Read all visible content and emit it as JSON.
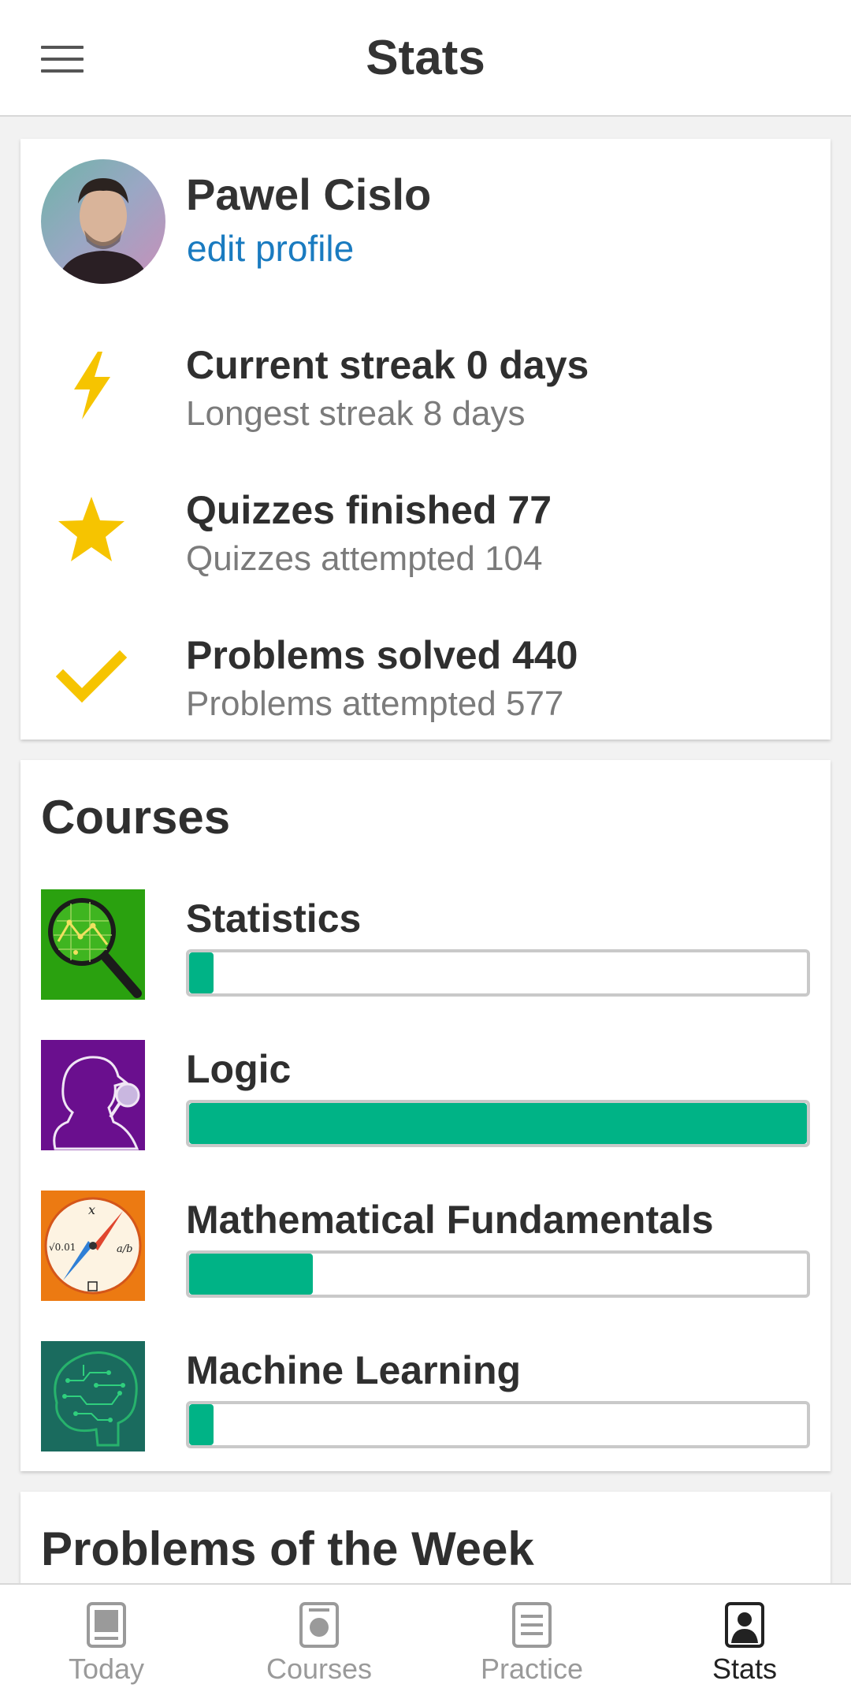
{
  "app_bar": {
    "title": "Stats",
    "menu_icon": "hamburger-menu-icon"
  },
  "profile": {
    "name": "Pawel Cislo",
    "edit_label": "edit profile",
    "stats": [
      {
        "icon": "lightning-icon",
        "main": "Current streak 0 days",
        "sub": "Longest streak 8 days"
      },
      {
        "icon": "star-icon",
        "main": "Quizzes finished 77",
        "sub": "Quizzes attempted 104"
      },
      {
        "icon": "checkmark-icon",
        "main": "Problems solved 440",
        "sub": "Problems attempted 577"
      }
    ]
  },
  "courses": {
    "title": "Courses",
    "items": [
      {
        "name": "Statistics",
        "progress": 0.04,
        "thumb_color": "#2aa10f"
      },
      {
        "name": "Logic",
        "progress": 1.0,
        "thumb_color": "#6a0f8e"
      },
      {
        "name": "Mathematical Fundamentals",
        "progress": 0.2,
        "thumb_color": "#ec7a12"
      },
      {
        "name": "Machine Learning",
        "progress": 0.04,
        "thumb_color": "#1a6b5e"
      }
    ]
  },
  "problems_of_week": {
    "title": "Problems of the Week"
  },
  "bottom_nav": {
    "items": [
      {
        "label": "Today",
        "active": false
      },
      {
        "label": "Courses",
        "active": false
      },
      {
        "label": "Practice",
        "active": false
      },
      {
        "label": "Stats",
        "active": true
      }
    ]
  },
  "colors": {
    "accent_blue": "#1a7bc0",
    "progress_green": "#00b386",
    "icon_yellow": "#f6c400"
  }
}
